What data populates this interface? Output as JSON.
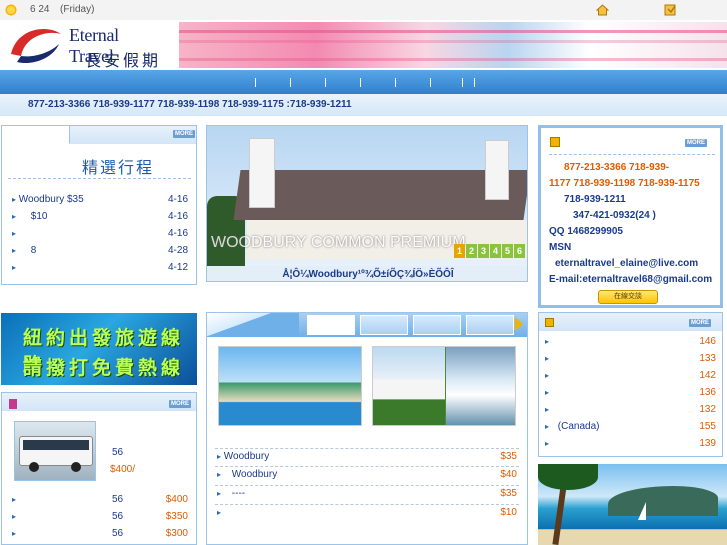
{
  "topbar": {
    "date": "6 24",
    "weekday": "(Friday)"
  },
  "logo": {
    "title": "Eternal Travel",
    "subtitle": "長安假期"
  },
  "phones": "877-213-3366  718-939-1177  718-939-1198  718-939-1175      :718-939-1211",
  "hot": {
    "title": "精選行程",
    "more": "MORE",
    "items": [
      {
        "name": "Woodbury   $35",
        "date": "4-16"
      },
      {
        "name": "   $10",
        "date": "4-16"
      },
      {
        "name": "",
        "date": "4-16"
      },
      {
        "name": "   8",
        "date": "4-28"
      },
      {
        "name": "",
        "date": "4-12"
      }
    ]
  },
  "photo": {
    "caption": "WOODBURY COMMON PREMIUM",
    "numbers": [
      "1",
      "2",
      "3",
      "4",
      "5",
      "6"
    ],
    "under": "Å¦Ô¼Woodbury¹º¾Õ±íÕÇ¾ÍÖ»ÈÕÔÎ"
  },
  "contact": {
    "more": "MORE",
    "line1": "877-213-3366  718-939-",
    "line2": "1177  718-939-1198  718-939-1175",
    "line3": "718-939-1211",
    "line4": "347-421-0932(24   )",
    "qq": "QQ  1468299905",
    "msn": "MSN",
    "msn_email": "eternaltravel_elaine@live.com",
    "email": "E-mail:eternaltravel68@gmail.com",
    "chat": "在線交談"
  },
  "promo": {
    "line1": "紐約出發旅遊線路",
    "line2": "請撥打免費熱線"
  },
  "bus": {
    "more": "MORE",
    "feature_name": "56",
    "feature_price": "$400/",
    "items": [
      {
        "name": "56",
        "price": "$400"
      },
      {
        "name": "56",
        "price": "$350"
      },
      {
        "name": "56",
        "price": "$300"
      }
    ]
  },
  "center_list": [
    {
      "name": "Woodbury",
      "price": "$35"
    },
    {
      "name": "  Woodbury",
      "price": "$40"
    },
    {
      "name": "  ----",
      "price": "$35"
    },
    {
      "name": "",
      "price": "$10"
    }
  ],
  "right_list": {
    "more": "MORE",
    "items": [
      {
        "name": "",
        "price": "146"
      },
      {
        "name": "",
        "price": "133"
      },
      {
        "name": "",
        "price": "142"
      },
      {
        "name": "",
        "price": "136"
      },
      {
        "name": "",
        "price": "132"
      },
      {
        "name": "  (Canada)",
        "price": "155"
      },
      {
        "name": "",
        "price": "139"
      }
    ]
  },
  "colors": {
    "accent": "#2f7fcf",
    "price": "#e05a00",
    "link": "#1a3a8a"
  }
}
